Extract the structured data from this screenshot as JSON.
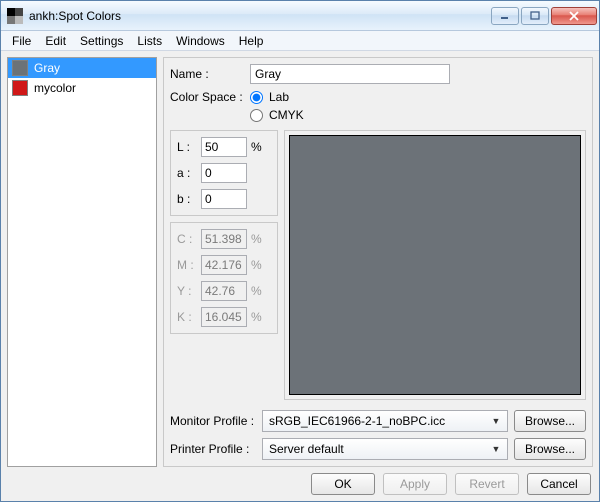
{
  "window": {
    "title": "ankh:Spot Colors"
  },
  "menu": [
    "File",
    "Edit",
    "Settings",
    "Lists",
    "Windows",
    "Help"
  ],
  "list": {
    "items": [
      {
        "label": "Gray",
        "color": "#6c7278",
        "selected": true
      },
      {
        "label": "mycolor",
        "color": "#d01818",
        "selected": false
      }
    ]
  },
  "fields": {
    "name_label": "Name :",
    "name_value": "Gray",
    "colorspace_label": "Color Space :",
    "radio_lab": "Lab",
    "radio_cmyk": "CMYK",
    "lab": {
      "L_label": "L :",
      "L": "50",
      "a_label": "a :",
      "a": "0",
      "b_label": "b :",
      "b": "0",
      "pct": "%"
    },
    "cmyk": {
      "C_label": "C :",
      "C": "51.398",
      "M_label": "M :",
      "M": "42.176",
      "Y_label": "Y :",
      "Y": "42.76",
      "K_label": "K :",
      "K": "16.045",
      "pct": "%"
    }
  },
  "preview_color": "#6c7278",
  "profiles": {
    "monitor_label": "Monitor Profile :",
    "monitor_value": "sRGB_IEC61966-2-1_noBPC.icc",
    "printer_label": "Printer Profile :",
    "printer_value": "Server default",
    "browse": "Browse..."
  },
  "buttons": {
    "ok": "OK",
    "apply": "Apply",
    "revert": "Revert",
    "cancel": "Cancel"
  }
}
